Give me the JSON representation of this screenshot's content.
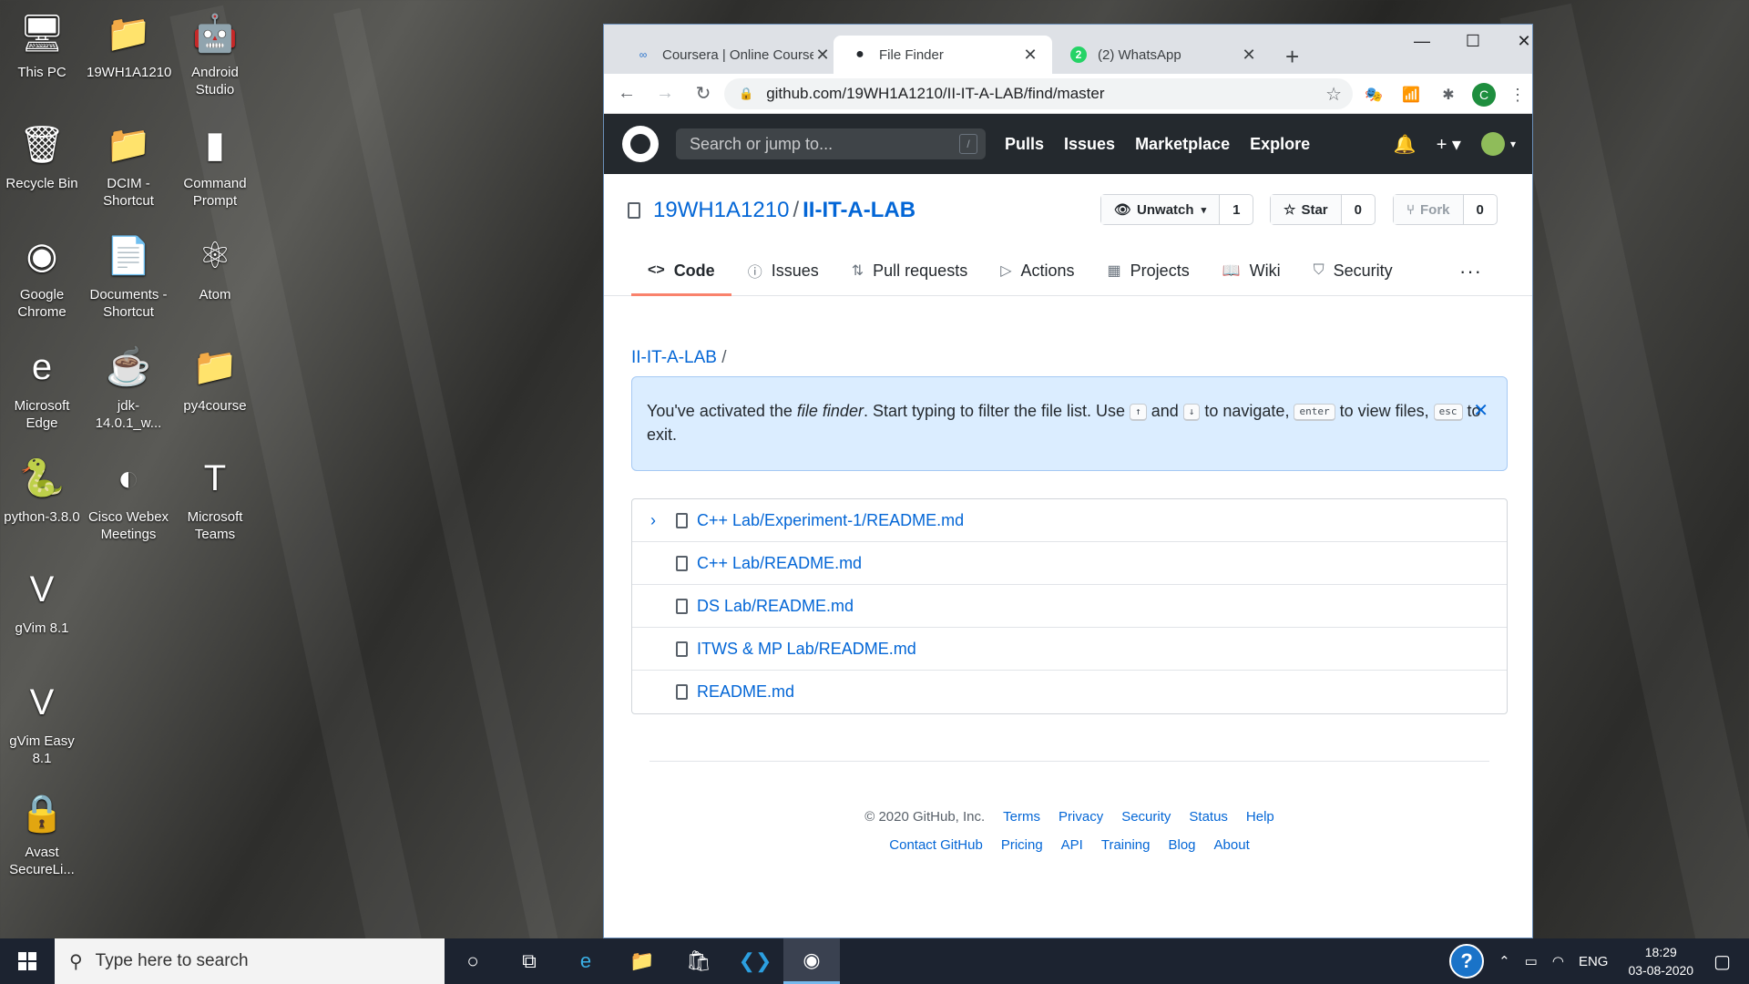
{
  "desktop": {
    "icons": [
      {
        "label": "This PC",
        "glyph": "🖥"
      },
      {
        "label": "19WH1A1210",
        "glyph": "📁"
      },
      {
        "label": "Android Studio",
        "glyph": "🤖"
      },
      {
        "label": "Recycle Bin",
        "glyph": "🗑"
      },
      {
        "label": "DCIM - Shortcut",
        "glyph": "📁"
      },
      {
        "label": "Command Prompt",
        "glyph": "▮"
      },
      {
        "label": "Google Chrome",
        "glyph": "◉"
      },
      {
        "label": "Documents - Shortcut",
        "glyph": "📄"
      },
      {
        "label": "Atom",
        "glyph": "⚛"
      },
      {
        "label": "Microsoft Edge",
        "glyph": "e"
      },
      {
        "label": "jdk-14.0.1_w...",
        "glyph": "☕"
      },
      {
        "label": "py4course",
        "glyph": "📁"
      },
      {
        "label": "python-3.8.0",
        "glyph": "🐍"
      },
      {
        "label": "Cisco Webex Meetings",
        "glyph": "◐"
      },
      {
        "label": "Microsoft Teams",
        "glyph": "T"
      },
      {
        "label": "gVim 8.1",
        "glyph": "V"
      },
      {
        "label": "gVim Easy 8.1",
        "glyph": "V"
      },
      {
        "label": "Avast SecureLi...",
        "glyph": "🔒"
      }
    ]
  },
  "browser": {
    "tabs": [
      {
        "title": "Coursera | Online Courses",
        "favicon": "∞"
      },
      {
        "title": "File Finder",
        "favicon": "●"
      },
      {
        "title": "(2) WhatsApp",
        "favicon": "2"
      }
    ],
    "new_tab": "+",
    "window_controls": {
      "minimize": "—",
      "maximize": "☐",
      "close": "✕"
    },
    "url": "github.com/19WH1A1210/II-IT-A-LAB/find/master",
    "profile_initial": "C"
  },
  "github": {
    "search_placeholder": "Search or jump to...",
    "search_key": "/",
    "nav": [
      "Pulls",
      "Issues",
      "Marketplace",
      "Explore"
    ],
    "owner": "19WH1A1210",
    "repo": "II-IT-A-LAB",
    "unwatch": {
      "label": "Unwatch",
      "count": "1"
    },
    "star": {
      "label": "Star",
      "count": "0"
    },
    "fork": {
      "label": "Fork",
      "count": "0"
    },
    "repo_tabs": [
      {
        "label": "Code",
        "icon": "<>"
      },
      {
        "label": "Issues",
        "icon": "ⓘ"
      },
      {
        "label": "Pull requests",
        "icon": "⇅"
      },
      {
        "label": "Actions",
        "icon": "▷"
      },
      {
        "label": "Projects",
        "icon": "▦"
      },
      {
        "label": "Wiki",
        "icon": "📖"
      },
      {
        "label": "Security",
        "icon": "⛉"
      }
    ],
    "more": "···",
    "breadcrumb": "II-IT-A-LAB",
    "flash": {
      "part1": "You've activated the ",
      "emph": "file finder",
      "part2": ". Start typing to filter the file list. Use ",
      "key_up": "↑",
      "and": " and ",
      "key_down": "↓",
      "part3": " to navigate, ",
      "key_enter": "enter",
      "part4": " to view files, ",
      "key_esc": "esc",
      "part5": " to exit."
    },
    "files": [
      "C++ Lab/Experiment-1/README.md",
      "C++ Lab/README.md",
      "DS Lab/README.md",
      "ITWS & MP Lab/README.md",
      "README.md"
    ],
    "footer_row1": [
      "© 2020 GitHub, Inc.",
      "Terms",
      "Privacy",
      "Security",
      "Status",
      "Help"
    ],
    "footer_row2": [
      "Contact GitHub",
      "Pricing",
      "API",
      "Training",
      "Blog",
      "About"
    ]
  },
  "taskbar": {
    "search_placeholder": "Type here to search",
    "language": "ENG",
    "time": "18:29",
    "date": "03-08-2020"
  }
}
